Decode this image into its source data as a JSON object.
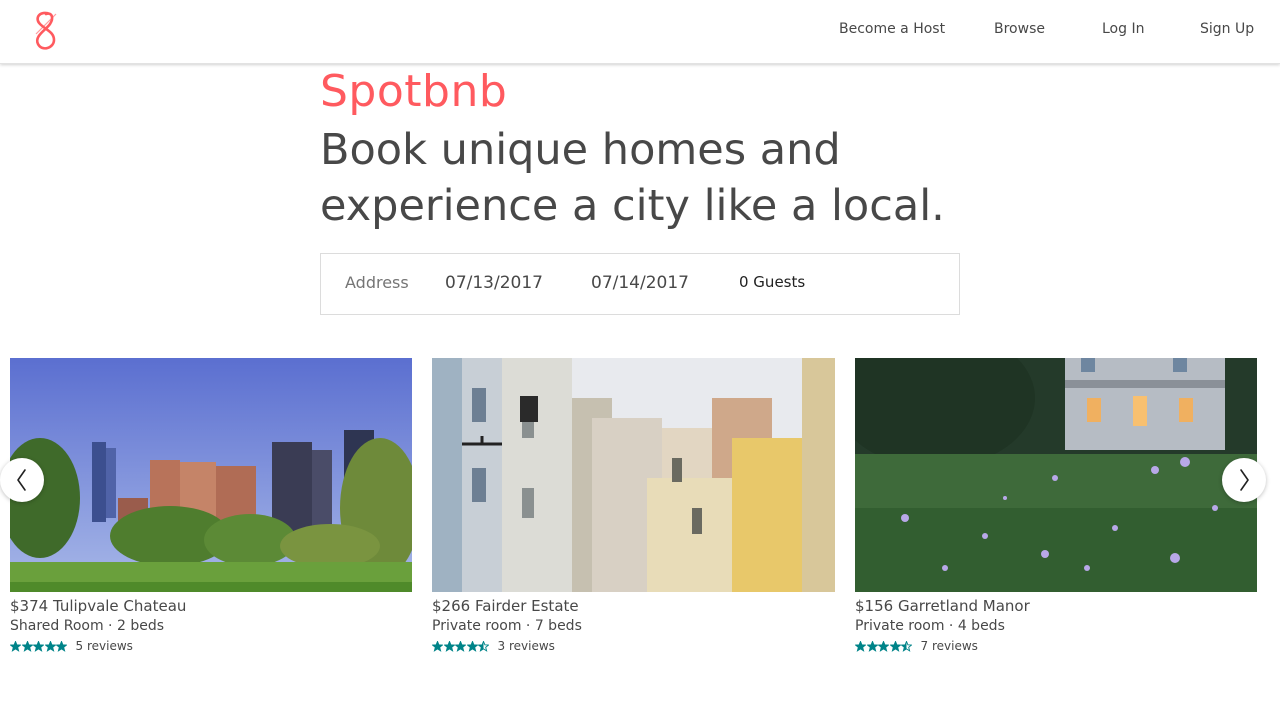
{
  "header": {
    "logo_icon": "spotbnb-logo-icon",
    "nav": {
      "become_host": "Become a Host",
      "browse": "Browse",
      "log_in": "Log In",
      "sign_up": "Sign Up"
    }
  },
  "hero": {
    "brand": "Spotbnb",
    "tagline": "Book unique homes and experience a city like a local.",
    "brand_color": "#ff5a5f"
  },
  "search": {
    "address_placeholder": "Address",
    "check_in": "07/13/2017",
    "check_out": "07/14/2017",
    "guests": "0 Guests"
  },
  "listings": [
    {
      "title": "$374 Tulipvale Chateau",
      "subtitle": "Shared Room · 2 beds",
      "rating": 5,
      "reviews": "5 reviews",
      "image": "city-park-skyline-photo"
    },
    {
      "title": "$266 Fairder Estate",
      "subtitle": "Private room · 7 beds",
      "rating": 4.5,
      "reviews": "3 reviews",
      "image": "narrow-street-buildings-photo"
    },
    {
      "title": "$156 Garretland Manor",
      "subtitle": "Private room · 4 beds",
      "rating": 4.5,
      "reviews": "7 reviews",
      "image": "flower-meadow-house-photo"
    }
  ],
  "carousel": {
    "prev_icon": "chevron-left-icon",
    "next_icon": "chevron-right-icon"
  },
  "colors": {
    "accent": "#ff5a5f",
    "star": "#008489",
    "text": "#484848"
  }
}
